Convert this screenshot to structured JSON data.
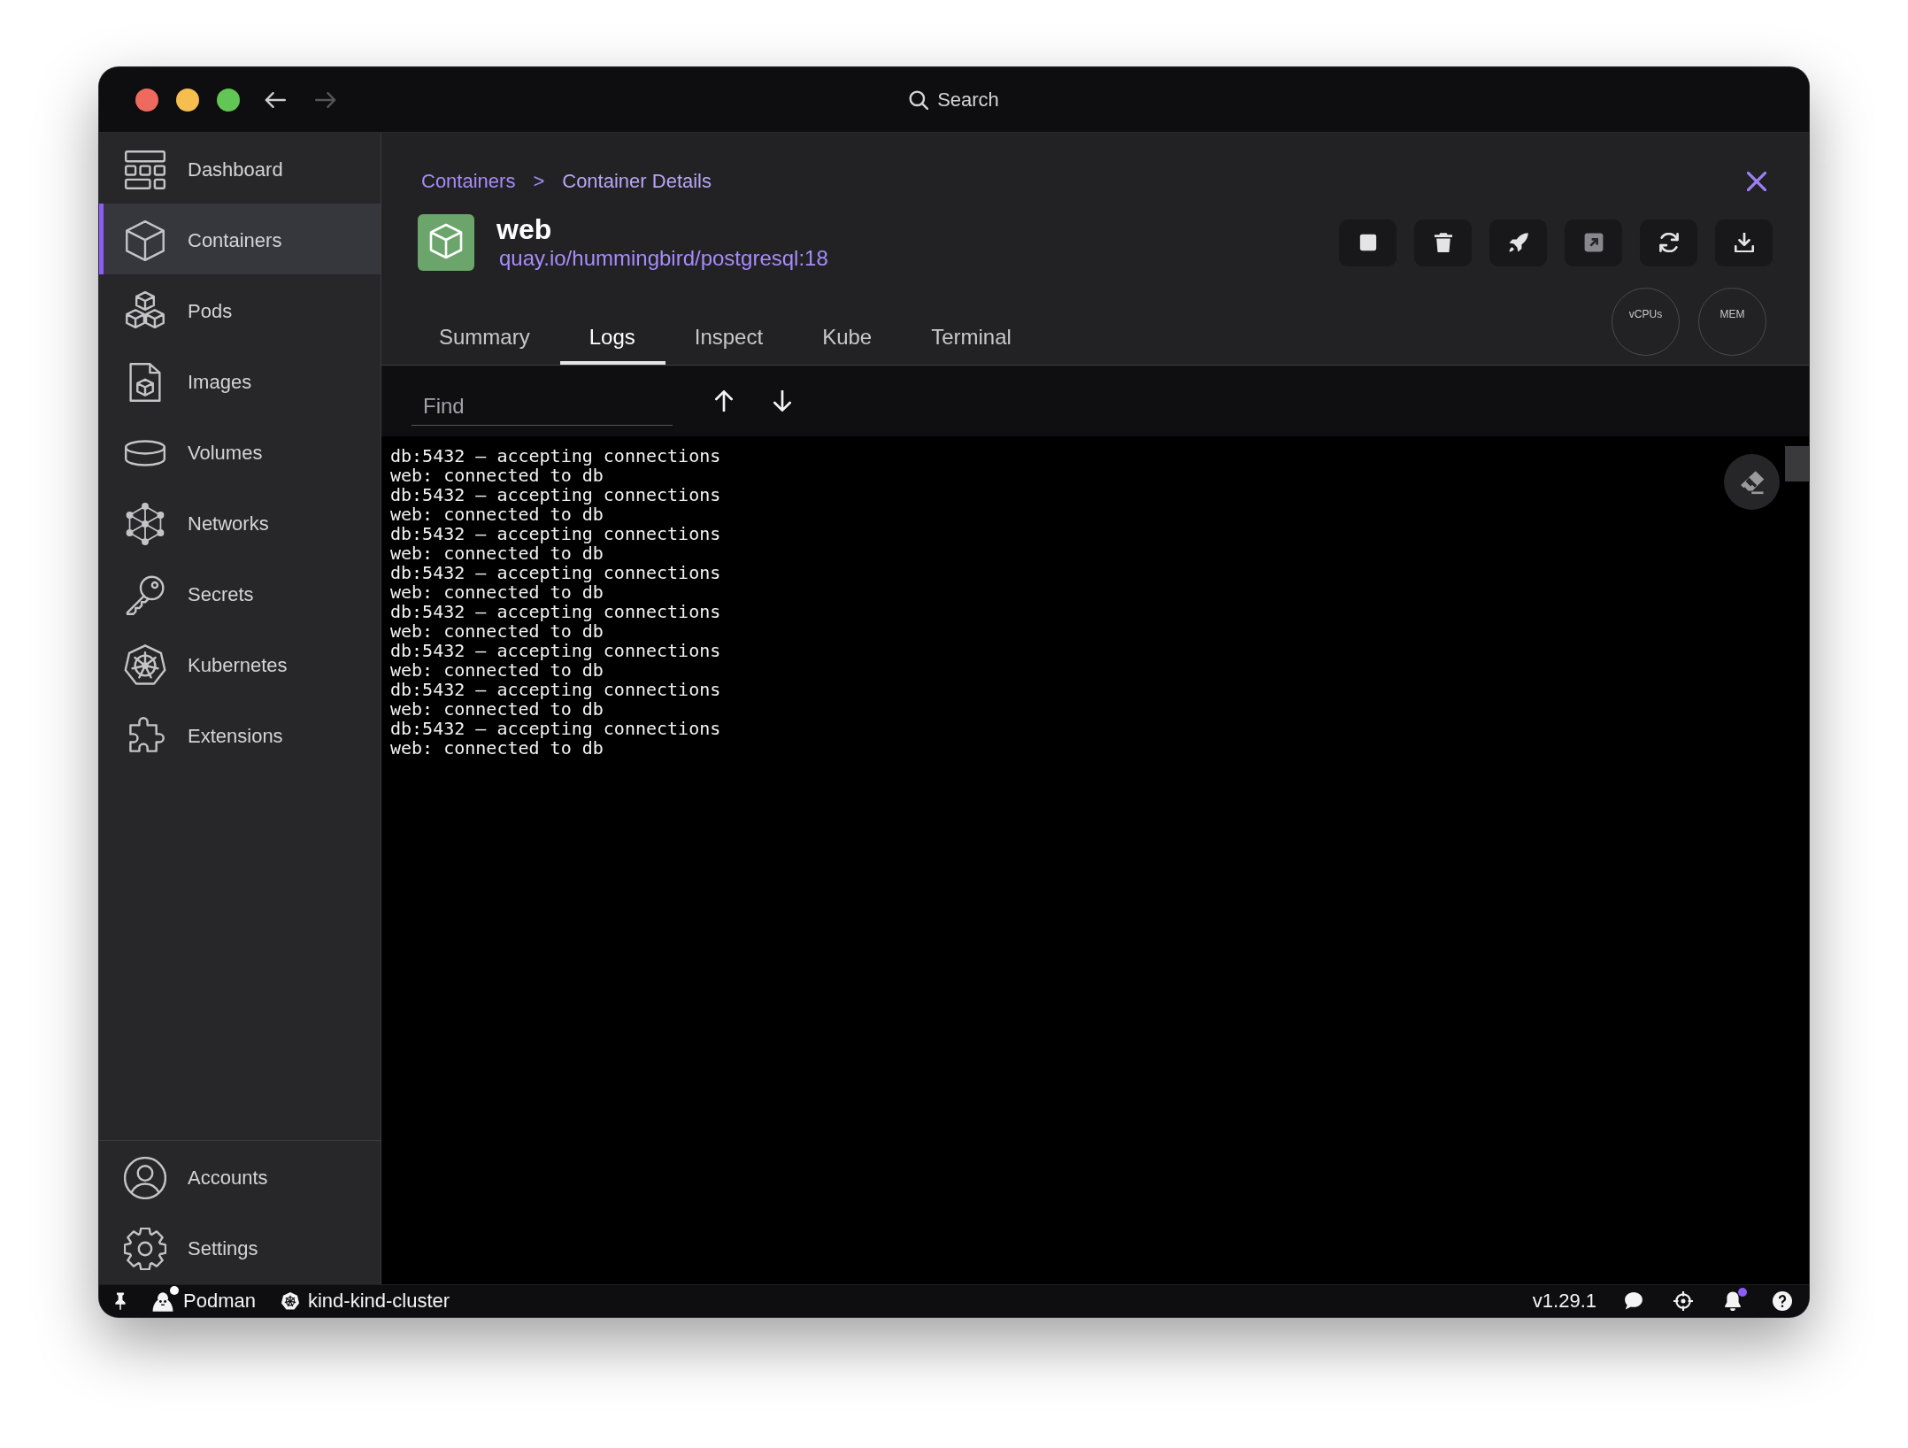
{
  "title_bar": {
    "nav_buttons": [
      {
        "kind": "back",
        "disabled": false
      },
      {
        "kind": "forward",
        "disabled": true
      }
    ],
    "search": {
      "label": "Search"
    }
  },
  "sidebar": {
    "items": [
      {
        "kind": "dashboard",
        "label": "Dashboard",
        "selected": false
      },
      {
        "kind": "containers",
        "label": "Containers",
        "selected": true
      },
      {
        "kind": "pods",
        "label": "Pods",
        "selected": false
      },
      {
        "kind": "images",
        "label": "Images",
        "selected": false
      },
      {
        "kind": "volumes",
        "label": "Volumes",
        "selected": false
      },
      {
        "kind": "networks",
        "label": "Networks",
        "selected": false
      },
      {
        "kind": "secrets",
        "label": "Secrets",
        "selected": false
      },
      {
        "kind": "kubernetes",
        "label": "Kubernetes",
        "selected": false
      },
      {
        "kind": "extensions",
        "label": "Extensions",
        "selected": false
      }
    ],
    "footer_items": [
      {
        "kind": "accounts",
        "label": "Accounts",
        "selected": false
      },
      {
        "kind": "settings",
        "label": "Settings",
        "selected": false
      }
    ]
  },
  "details": {
    "breadcrumb": {
      "parent": "Containers",
      "separator": ">",
      "current": "Container Details"
    },
    "name": "web",
    "image": "quay.io/hummingbird/postgresql:18",
    "actions": [
      {
        "kind": "stop",
        "disabled": false
      },
      {
        "kind": "delete",
        "disabled": false
      },
      {
        "kind": "deploy",
        "disabled": false
      },
      {
        "kind": "open",
        "disabled": true
      },
      {
        "kind": "restart",
        "disabled": false
      },
      {
        "kind": "export",
        "disabled": false
      }
    ],
    "stats": [
      {
        "label": "vCPUs"
      },
      {
        "label": "MEM"
      }
    ],
    "tabs": [
      {
        "label": "Summary",
        "selected": false
      },
      {
        "label": "Logs",
        "selected": true
      },
      {
        "label": "Inspect",
        "selected": false
      },
      {
        "label": "Kube",
        "selected": false
      },
      {
        "label": "Terminal",
        "selected": false
      }
    ]
  },
  "logs": {
    "find": {
      "placeholder": "Find"
    },
    "lines": [
      "db:5432 – accepting connections",
      "web: connected to db",
      "db:5432 – accepting connections",
      "web: connected to db",
      "db:5432 – accepting connections",
      "web: connected to db",
      "db:5432 – accepting connections",
      "web: connected to db",
      "db:5432 – accepting connections",
      "web: connected to db",
      "db:5432 – accepting connections",
      "web: connected to db",
      "db:5432 – accepting connections",
      "web: connected to db",
      "db:5432 – accepting connections",
      "web: connected to db"
    ]
  },
  "status_bar": {
    "left": [
      {
        "kind": "pin",
        "dot": false
      },
      {
        "kind": "engine",
        "label": "Podman",
        "dot": true
      },
      {
        "kind": "kubernetes",
        "label": "kind-kind-cluster",
        "dot": false
      }
    ],
    "version": "v1.29.1",
    "right": [
      {
        "kind": "chat",
        "dot": false
      },
      {
        "kind": "crosshair",
        "dot": false
      },
      {
        "kind": "bell",
        "dot": true
      },
      {
        "kind": "help",
        "dot": false
      }
    ]
  }
}
